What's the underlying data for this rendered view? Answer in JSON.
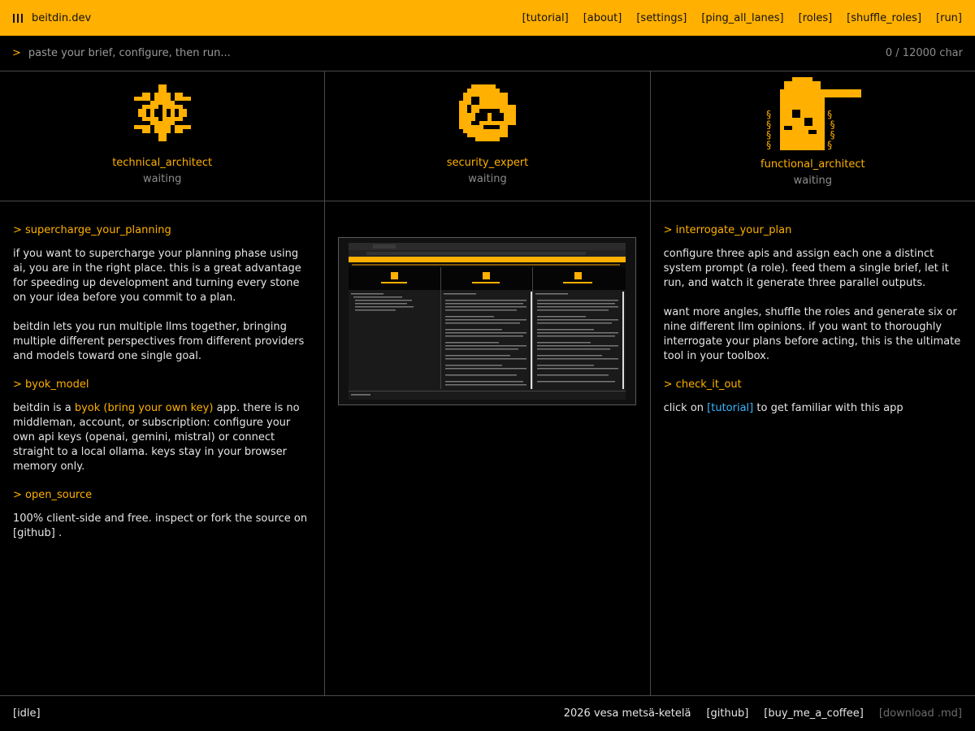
{
  "app": {
    "title": "beitdin.dev"
  },
  "nav": [
    "[tutorial]",
    "[about]",
    "[settings]",
    "[ping_all_lanes]",
    "[roles]",
    "[shuffle_roles]",
    "[run]"
  ],
  "prompt": {
    "caret": ">",
    "placeholder": "paste your brief, configure, then run...",
    "counter": "0 / 12000 char"
  },
  "agents": [
    {
      "name": "technical_architect",
      "status": "waiting",
      "icon": "gear-icon"
    },
    {
      "name": "security_expert",
      "status": "waiting",
      "icon": "lock-icon"
    },
    {
      "name": "functional_architect",
      "status": "waiting",
      "icon": "building-icon"
    }
  ],
  "col1": {
    "h1": "> supercharge_your_planning",
    "p1": "if you want to supercharge your planning phase using ai, you are in the right place. this is a great advantage for speeding up development and turning every stone on your idea before you commit to a plan.",
    "p2": "beitdin lets you run multiple llms together, bringing multiple different perspectives from different providers and models toward one single goal.",
    "h2": "> byok_model",
    "p3_pre": "beitdin is a ",
    "p3_hl": "byok (bring your own key)",
    "p3_post": " app. there is no middleman, account, or subscription: configure your own api keys (openai, gemini, mistral) or connect straight to a local ollama. keys stay in your browser memory only.",
    "h3": "> open_source",
    "p4_pre": "100% client-side and free. inspect or fork the source on ",
    "p4_link": "[github]",
    "p4_post": " ."
  },
  "col3": {
    "h1": "> interrogate_your_plan",
    "p1": "configure three apis and assign each one a distinct system prompt (a role). feed them a single brief, let it run, and watch it generate three parallel outputs.",
    "p2": "want more angles, shuffle the roles and generate six or nine different llm opinions. if you want to thoroughly interrogate your plans before acting, this is the ultimate tool in your toolbox.",
    "h2": "> check_it_out",
    "p3_pre": "click on ",
    "p3_link": "[tutorial]",
    "p3_post": " to get familiar with this app"
  },
  "footer": {
    "status": "[idle]",
    "copyright": "2026 vesa metsä-ketelä",
    "github": "[github]",
    "coffee": "[buy_me_a_coffee]",
    "download": "[download .md]"
  },
  "colors": {
    "accent": "#ffb000",
    "background": "#000000",
    "link": "#3bb6ff",
    "border": "#4a4a4a"
  }
}
